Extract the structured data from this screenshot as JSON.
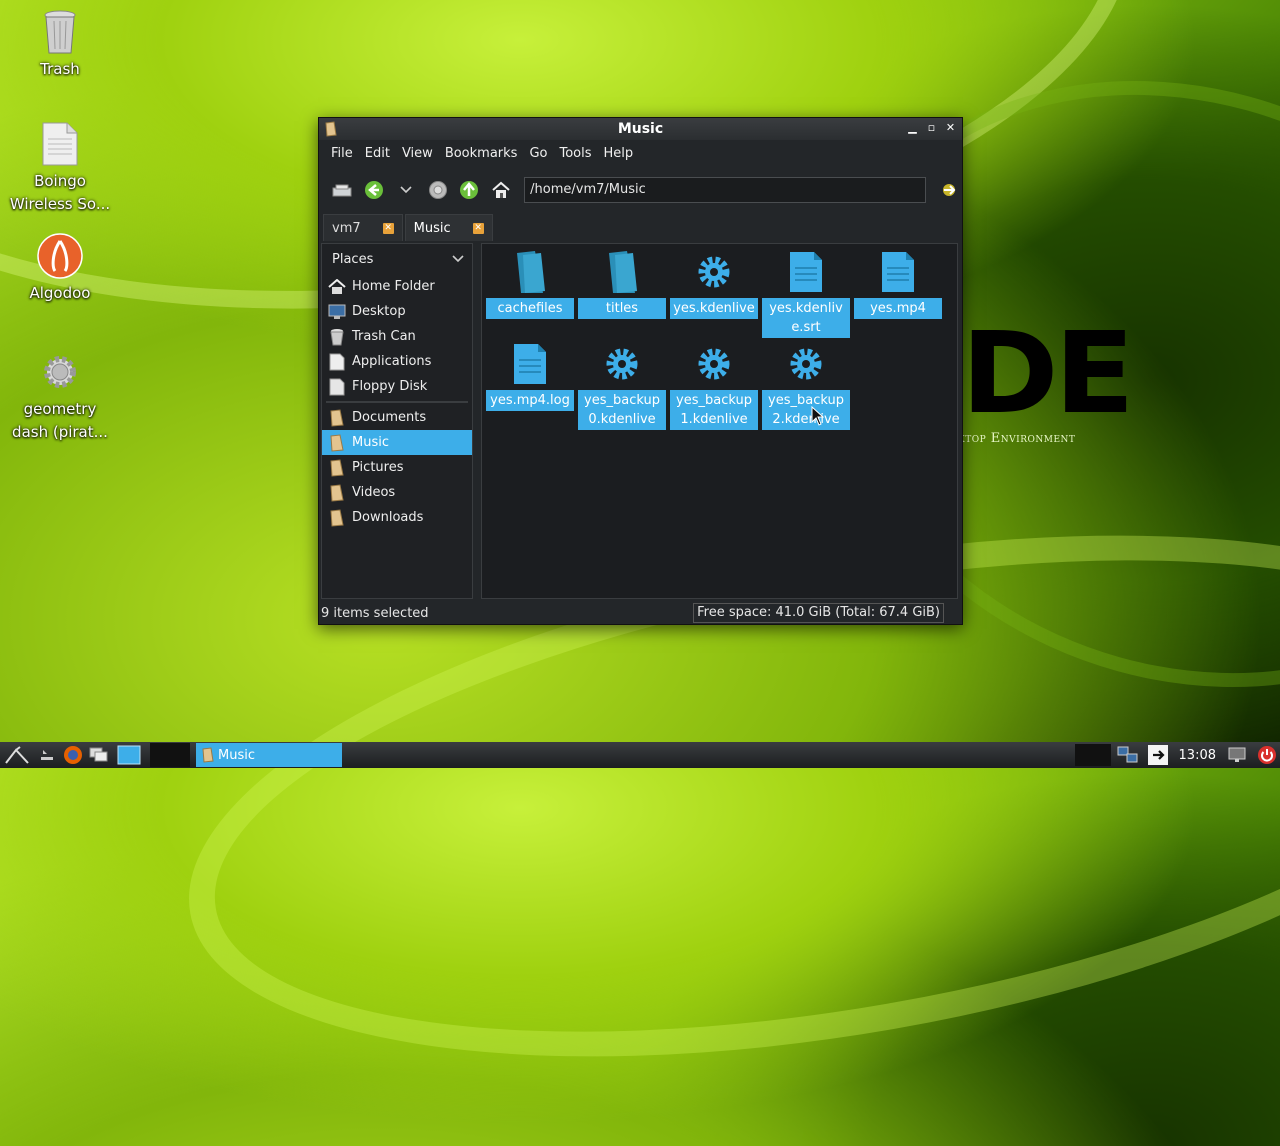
{
  "desktop": {
    "icons": [
      {
        "label": "Trash"
      },
      {
        "label": "Boingo Wireless So..."
      },
      {
        "label": "Algodoo"
      },
      {
        "label": "geometry dash (pirat..."
      }
    ],
    "wallpaper_subtitle": "ktop Environment"
  },
  "window": {
    "title": "Music",
    "menu": [
      "File",
      "Edit",
      "View",
      "Bookmarks",
      "Go",
      "Tools",
      "Help"
    ],
    "location": "/home/vm7/Music",
    "tabs": [
      {
        "label": "vm7"
      },
      {
        "label": "Music"
      }
    ],
    "places_header": "Places",
    "places": [
      {
        "label": "Home Folder",
        "icon": "home-icon"
      },
      {
        "label": "Desktop",
        "icon": "desktop-icon"
      },
      {
        "label": "Trash Can",
        "icon": "trash-icon"
      },
      {
        "label": "Applications",
        "icon": "applications-icon"
      },
      {
        "label": "Floppy Disk",
        "icon": "floppy-icon"
      }
    ],
    "bookmarks": [
      {
        "label": "Documents"
      },
      {
        "label": "Music"
      },
      {
        "label": "Pictures"
      },
      {
        "label": "Videos"
      },
      {
        "label": "Downloads"
      }
    ],
    "files": [
      {
        "name": "cachefiles",
        "kind": "folder"
      },
      {
        "name": "titles",
        "kind": "folder"
      },
      {
        "name": "yes.kdenlive",
        "kind": "gear"
      },
      {
        "name": "yes.kdenlive.srt",
        "kind": "doc"
      },
      {
        "name": "yes.mp4",
        "kind": "doc"
      },
      {
        "name": "yes.mp4.log",
        "kind": "doc"
      },
      {
        "name": "yes_backup0.kdenlive",
        "kind": "gear"
      },
      {
        "name": "yes_backup1.kdenlive",
        "kind": "gear"
      },
      {
        "name": "yes_backup2.kdenlive",
        "kind": "gear"
      }
    ],
    "status_left": "9 items selected",
    "status_right": "Free space: 41.0 GiB (Total: 67.4 GiB)"
  },
  "taskbar": {
    "task_label": "Music",
    "clock": "13:08"
  },
  "colors": {
    "accent": "#3daee9",
    "window_bg": "#232629"
  }
}
